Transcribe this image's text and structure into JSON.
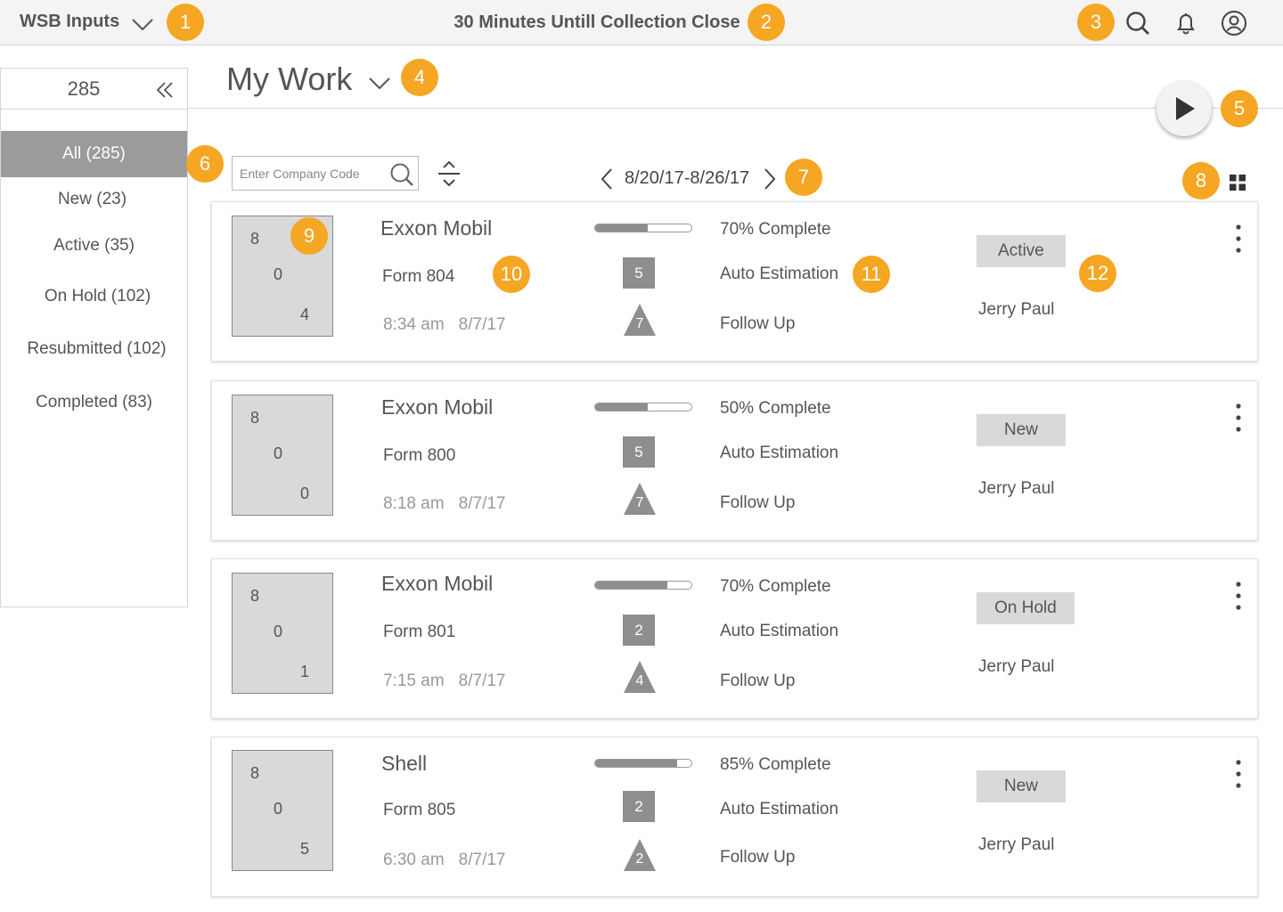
{
  "topbar": {
    "app_title": "WSB Inputs",
    "center_title": "30 Minutes Untill Collection Close",
    "icons": [
      "search-icon",
      "bell-icon",
      "user-icon"
    ]
  },
  "sidebar": {
    "count": "285",
    "items": [
      {
        "label": "All (285)",
        "selected": true
      },
      {
        "label": "New (23)",
        "selected": false
      },
      {
        "label": "Active (35)",
        "selected": false
      },
      {
        "label": "On Hold (102)",
        "selected": false
      },
      {
        "label": "Resubmitted (102)",
        "selected": false
      },
      {
        "label": "Completed (83)",
        "selected": false
      }
    ]
  },
  "main": {
    "title": "My Work",
    "search_placeholder": "Enter Company Code",
    "date_range": "8/20/17-8/26/17"
  },
  "callouts": [
    "1",
    "2",
    "3",
    "4",
    "5",
    "6",
    "7",
    "8",
    "9",
    "10",
    "11",
    "12"
  ],
  "cards": [
    {
      "thumb": [
        "8",
        "0",
        "4"
      ],
      "company": "Exxon Mobil",
      "form": "Form 804",
      "time": "8:34 am",
      "date": "8/7/17",
      "progress": 0.55,
      "square_count": "5",
      "triangle_count": "7",
      "percent_label": "70% Complete",
      "estimation": "Auto Estimation",
      "follow": "Follow Up",
      "status": "Active",
      "assignee": "Jerry Paul"
    },
    {
      "thumb": [
        "8",
        "0",
        "0"
      ],
      "company": "Exxon Mobil",
      "form": "Form 800",
      "time": "8:18 am",
      "date": "8/7/17",
      "progress": 0.55,
      "square_count": "5",
      "triangle_count": "7",
      "percent_label": "50% Complete",
      "estimation": "Auto Estimation",
      "follow": "Follow Up",
      "status": "New",
      "assignee": "Jerry Paul"
    },
    {
      "thumb": [
        "8",
        "0",
        "1"
      ],
      "company": "Exxon Mobil",
      "form": "Form 801",
      "time": "7:15 am",
      "date": "8/7/17",
      "progress": 0.75,
      "square_count": "2",
      "triangle_count": "4",
      "percent_label": "70% Complete",
      "estimation": "Auto Estimation",
      "follow": "Follow Up",
      "status": "On Hold",
      "assignee": "Jerry Paul"
    },
    {
      "thumb": [
        "8",
        "0",
        "5"
      ],
      "company": "Shell",
      "form": "Form 805",
      "time": "6:30 am",
      "date": "8/7/17",
      "progress": 0.85,
      "square_count": "2",
      "triangle_count": "2",
      "percent_label": "85% Complete",
      "estimation": "Auto Estimation",
      "follow": "Follow Up",
      "status": "New",
      "assignee": "Jerry Paul"
    }
  ],
  "colors": {
    "callout": "#f5a623",
    "selected_bg": "#9b9b9b",
    "badge_bg": "#8e8e8e",
    "status_bg": "#d9d9d9"
  }
}
